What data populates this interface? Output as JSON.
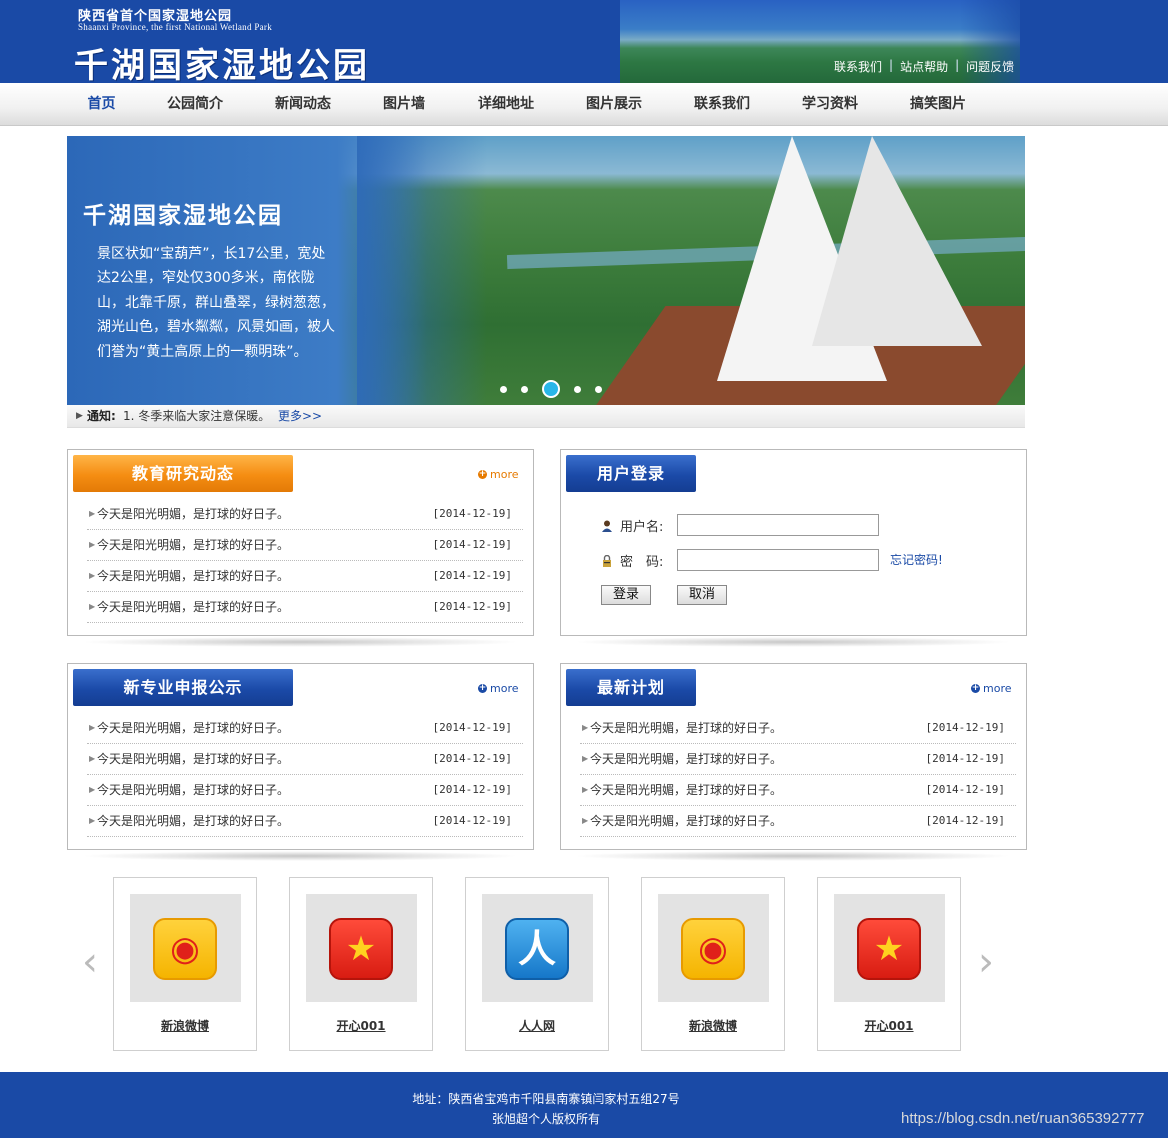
{
  "header": {
    "subtitle_cn": "陕西省首个国家湿地公园",
    "subtitle_en": "Shaanxi Province, the first National Wetland Park",
    "title": "千湖国家湿地公园",
    "links": [
      "联系我们",
      "站点帮助",
      "问题反馈"
    ],
    "separator": "|"
  },
  "nav": {
    "items": [
      "首页",
      "公园简介",
      "新闻动态",
      "图片墙",
      "详细地址",
      "图片展示",
      "联系我们",
      "学习资料",
      "搞笑图片"
    ],
    "active_index": 0
  },
  "banner": {
    "title": "千湖国家湿地公园",
    "text": "景区状如“宝葫芦”，长17公里，宽处达2公里，窄处仅300多米，南依陇山，北靠千原，群山叠翠，绿树葱葱，湖光山色，碧水粼粼，风景如画，被人们誉为“黄土高原上的一颗明珠”。",
    "slide_count": 5,
    "active_slide": 2
  },
  "notice": {
    "label": "通知:",
    "text": "1. 冬季来临大家注意保暖。",
    "more": "更多>>"
  },
  "panels": {
    "education": {
      "title": "教育研究动态",
      "more": "more",
      "items": [
        {
          "title": "今天是阳光明媚，是打球的好日子。",
          "date": "[2014-12-19]"
        },
        {
          "title": "今天是阳光明媚，是打球的好日子。",
          "date": "[2014-12-19]"
        },
        {
          "title": "今天是阳光明媚，是打球的好日子。",
          "date": "[2014-12-19]"
        },
        {
          "title": "今天是阳光明媚，是打球的好日子。",
          "date": "[2014-12-19]"
        }
      ]
    },
    "login": {
      "title": "用户登录",
      "username_label": "用户名:",
      "password_label": "密　码:",
      "username_value": "",
      "password_value": "",
      "forgot": "忘记密码!",
      "login_button": "登录",
      "cancel_button": "取消"
    },
    "majors": {
      "title": "新专业申报公示",
      "more": "more",
      "items": [
        {
          "title": "今天是阳光明媚，是打球的好日子。",
          "date": "[2014-12-19]"
        },
        {
          "title": "今天是阳光明媚，是打球的好日子。",
          "date": "[2014-12-19]"
        },
        {
          "title": "今天是阳光明媚，是打球的好日子。",
          "date": "[2014-12-19]"
        },
        {
          "title": "今天是阳光明媚，是打球的好日子。",
          "date": "[2014-12-19]"
        }
      ]
    },
    "plans": {
      "title": "最新计划",
      "more": "more",
      "items": [
        {
          "title": "今天是阳光明媚，是打球的好日子。",
          "date": "[2014-12-19]"
        },
        {
          "title": "今天是阳光明媚，是打球的好日子。",
          "date": "[2014-12-19]"
        },
        {
          "title": "今天是阳光明媚，是打球的好日子。",
          "date": "[2014-12-19]"
        },
        {
          "title": "今天是阳光明媚，是打球的好日子。",
          "date": "[2014-12-19]"
        }
      ]
    }
  },
  "links_carousel": {
    "items": [
      {
        "name": "新浪微博",
        "icon": "weibo-icon"
      },
      {
        "name": "开心001",
        "icon": "kaixin-icon"
      },
      {
        "name": "人人网",
        "icon": "renren-icon"
      },
      {
        "name": "新浪微博",
        "icon": "weibo-icon"
      },
      {
        "name": "开心001",
        "icon": "kaixin-icon"
      }
    ]
  },
  "footer": {
    "address": "地址：陕西省宝鸡市千阳县南寨镇闫家村五组27号",
    "copyright": "张旭超个人版权所有",
    "watermark": "https://blog.csdn.net/ruan365392777"
  },
  "colors": {
    "brand_blue": "#1a4aa6",
    "accent_orange": "#f58d12",
    "link_blue": "#1a4aa6"
  }
}
